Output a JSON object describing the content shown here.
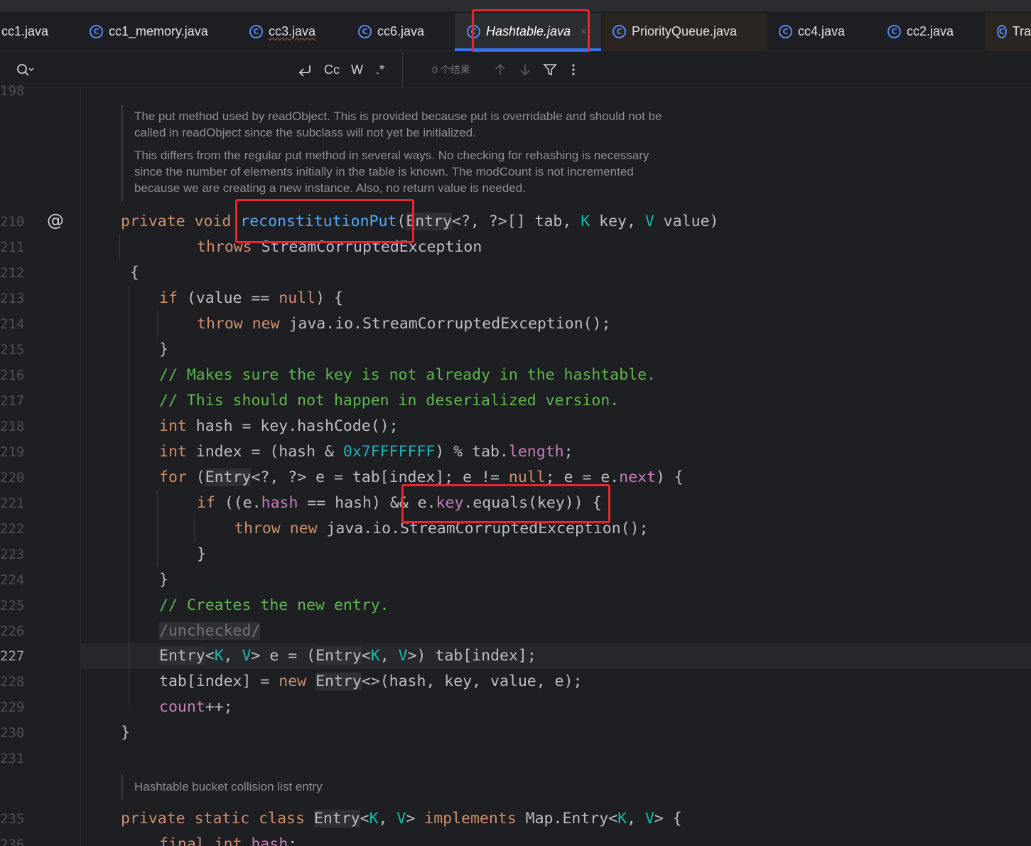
{
  "tabs": [
    {
      "label": "cc1.java",
      "active": false
    },
    {
      "label": "cc1_memory.java",
      "active": false
    },
    {
      "label": "cc3.java",
      "active": false
    },
    {
      "label": "cc6.java",
      "active": false
    },
    {
      "label": "Hashtable.java",
      "active": true
    },
    {
      "label": "PriorityQueue.java",
      "active": false
    },
    {
      "label": "cc4.java",
      "active": false
    },
    {
      "label": "cc2.java",
      "active": false
    },
    {
      "label": "Tra",
      "active": false
    }
  ],
  "search": {
    "results": "0 个结果",
    "case_label": "Cc",
    "word_label": "W",
    "regex_label": ".*"
  },
  "javadoc_1": {
    "para1_line1": "The put method used by readObject. This is provided because put is overridable and should not be",
    "para1_line2": "called in readObject since the subclass will not yet be initialized.",
    "para2_line1": "This differs from the regular put method in several ways. No checking for rehashing is necessary",
    "para2_line2": "since the number of elements initially in the table is known. The modCount is not incremented",
    "para2_line3": "because we are creating a new instance. Also, no return value is needed."
  },
  "javadoc_2": {
    "text": "Hashtable bucket collision list entry"
  },
  "line_numbers": {
    "top_partial": "198",
    "l210": "210",
    "l211": "211",
    "l212": "212",
    "l213": "213",
    "l214": "214",
    "l215": "215",
    "l216": "216",
    "l217": "217",
    "l218": "218",
    "l219": "219",
    "l220": "220",
    "l221": "221",
    "l222": "222",
    "l223": "223",
    "l224": "224",
    "l225": "225",
    "l226": "226",
    "l227": "227",
    "l228": "228",
    "l229": "229",
    "l230": "230",
    "l231": "231",
    "l235": "235",
    "l236": "236"
  },
  "code": {
    "l210": {
      "private": "private",
      "void": "void",
      "method": "reconstitutionPut",
      "open": "(",
      "entry": "Entry",
      "rest1": "<?, ?>[] tab, ",
      "K": "K",
      "key": " key, ",
      "V": "V",
      "value": " value)"
    },
    "l211": {
      "throws": "throws",
      "exc": " StreamCorruptedException"
    },
    "l212": {
      "brace": "{"
    },
    "l213": {
      "if": "if",
      "cond": " (value == ",
      "null": "null",
      "end": ") {"
    },
    "l214": {
      "throw": "throw",
      "new": "new",
      "rest": " java.io.StreamCorruptedException();"
    },
    "l215": {
      "brace": "}"
    },
    "l216": {
      "comment": "// Makes sure the key is not already in the hashtable."
    },
    "l217": {
      "comment": "// This should not happen in deserialized version."
    },
    "l218": {
      "int": "int",
      "rest": " hash = key.hashCode();"
    },
    "l219": {
      "int": "int",
      "rest1": " index = (hash & ",
      "hex": "0x7FFFFFFF",
      "rest2": ") % tab.",
      "length": "length",
      "end": ";"
    },
    "l220": {
      "for": "for",
      "open": " (",
      "entry": "Entry",
      "rest1": "<?, ?> e = tab[index]; e != ",
      "null": "null",
      "rest2": "; e = e.",
      "next": "next",
      "end": ") {"
    },
    "l221": {
      "if": "if",
      "rest1": " ((e.",
      "hash": "hash",
      "rest2": " == hash) && e.",
      "key": "key",
      "rest3": ".equals(key)) {"
    },
    "l222": {
      "throw": "throw",
      "new": "new",
      "rest": " java.io.StreamCorruptedException();"
    },
    "l223": {
      "brace": "}"
    },
    "l224": {
      "brace": "}"
    },
    "l225": {
      "comment": "// Creates the new entry."
    },
    "l226": {
      "annotation": "/unchecked/"
    },
    "l227": {
      "entry": "Entry",
      "lt": "<",
      "K": "K",
      "comma": ", ",
      "V": "V",
      "rest1": "> e = (",
      "entry2": "Entry",
      "lt2": "<",
      "K2": "K",
      "comma2": ", ",
      "V2": "V",
      "rest2": ">) tab[index];"
    },
    "l228": {
      "rest1": "tab[index] = ",
      "new": "new",
      "sp": " ",
      "entry": "Entry",
      "rest2": "<>(hash, key, value, e);"
    },
    "l229": {
      "count": "count",
      "rest": "++;"
    },
    "l230": {
      "brace": "}"
    },
    "l235": {
      "private": "private",
      "static": "static",
      "class": "class",
      "entry": "Entry",
      "lt": "<",
      "K": "K",
      "comma": ", ",
      "V": "V",
      "gt": ">",
      "implements": "implements",
      "rest1": " Map.Entry<",
      "K2": "K",
      "comma2": ", ",
      "V2": "V",
      "end": "> {"
    },
    "l236": {
      "final": "final",
      "int": "int",
      "hash": "hash",
      "end": ";"
    }
  },
  "colors": {
    "keyword": "#cf8e6d",
    "method": "#56a8f5",
    "field": "#c77dbb",
    "number": "#2aacb8",
    "comment": "#5fb84e",
    "type_param": "#16baac",
    "annotation_box": "#e8262b",
    "tab_underline": "#3574f0"
  }
}
